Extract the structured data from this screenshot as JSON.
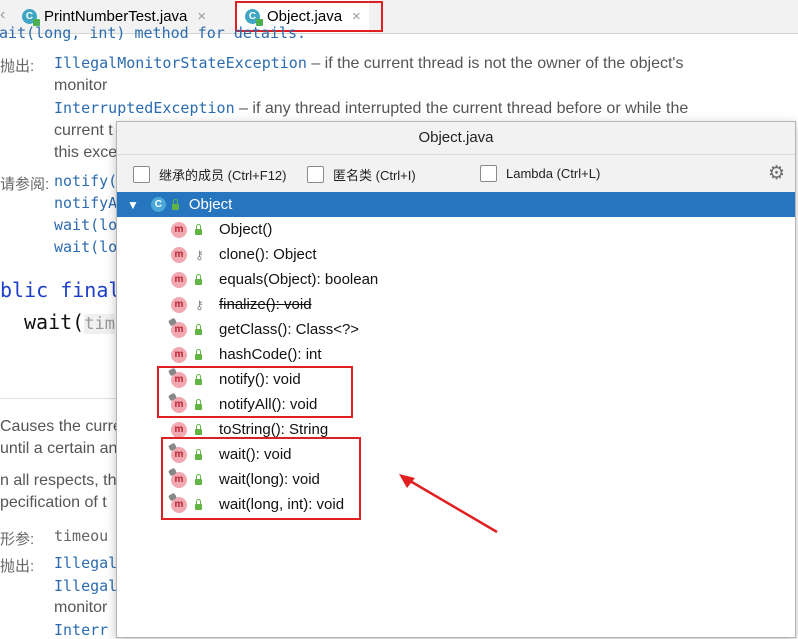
{
  "tabs": [
    {
      "label": "PrintNumberTest.java",
      "icon": "class-icon",
      "active": false
    },
    {
      "label": "Object.java",
      "icon": "class-icon",
      "active": true
    }
  ],
  "doc": {
    "top_fragment": "wait(long, int) method for details.",
    "throws_label": "抛出:",
    "ex1_name": "IllegalMonitorStateException",
    "ex1_desc": "– if the current thread is not the owner of the object's",
    "ex1_cont": "monitor",
    "ex2_name": "InterruptedException",
    "ex2_desc": "– if any thread interrupted the current thread before or while the",
    "ex2_cont": "current t",
    "ex2_cont2": "this exce",
    "see_label": "请参阅:",
    "see1": "notify(",
    "see2": "notifyA",
    "see3": "wait(lo",
    "see4": "wait(lo",
    "sig1": "blic final",
    "sig2": "wait(",
    "sig2_param": "tim",
    "para1a": "Causes the curre",
    "para1b": "until a certain an",
    "para2a": "n all respects, th",
    "para2b": "pecification of t",
    "params_label": "形参:",
    "param1": "timeou",
    "throws2_label": "抛出:",
    "ex3": "Illegal",
    "ex4": "Illegal",
    "ex4_cont": "monitor",
    "ex5": "Interr"
  },
  "popup": {
    "title": "Object.java",
    "filters": {
      "inherited": "继承的成员 (Ctrl+F12)",
      "anonymous": "匿名类 (Ctrl+I)",
      "lambda": "Lambda (Ctrl+L)"
    },
    "root": {
      "label": "Object",
      "icon": "class-icon"
    },
    "members": [
      {
        "label": "Object()",
        "visibility": "public",
        "deprecated": false,
        "overridable_pin": false
      },
      {
        "label": "clone(): Object",
        "visibility": "protected",
        "deprecated": false,
        "overridable_pin": false
      },
      {
        "label": "equals(Object): boolean",
        "visibility": "public",
        "deprecated": false,
        "overridable_pin": false
      },
      {
        "label": "finalize(): void",
        "visibility": "protected",
        "deprecated": true,
        "overridable_pin": false
      },
      {
        "label": "getClass(): Class<?>",
        "visibility": "public",
        "deprecated": false,
        "overridable_pin": true
      },
      {
        "label": "hashCode(): int",
        "visibility": "public",
        "deprecated": false,
        "overridable_pin": false
      },
      {
        "label": "notify(): void",
        "visibility": "public",
        "deprecated": false,
        "overridable_pin": true
      },
      {
        "label": "notifyAll(): void",
        "visibility": "public",
        "deprecated": false,
        "overridable_pin": true
      },
      {
        "label": "toString(): String",
        "visibility": "public",
        "deprecated": false,
        "overridable_pin": false
      },
      {
        "label": "wait(): void",
        "visibility": "public",
        "deprecated": false,
        "overridable_pin": true
      },
      {
        "label": "wait(long): void",
        "visibility": "public",
        "deprecated": false,
        "overridable_pin": true
      },
      {
        "label": "wait(long, int): void",
        "visibility": "public",
        "deprecated": false,
        "overridable_pin": true
      }
    ]
  },
  "colors": {
    "accent": "#2675bf",
    "annotation": "#e02020"
  }
}
